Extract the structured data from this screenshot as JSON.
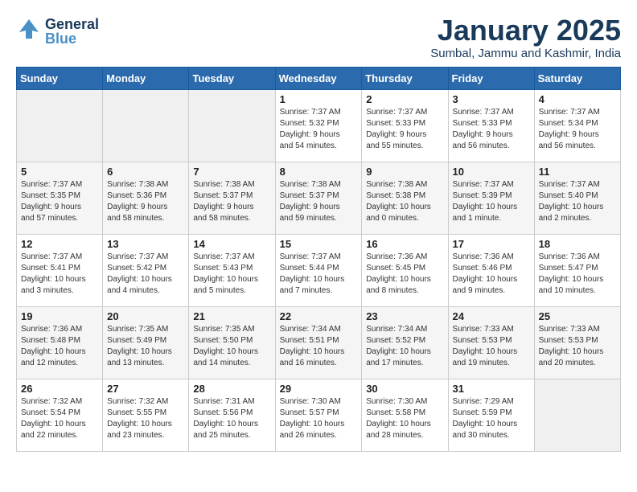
{
  "header": {
    "logo_general": "General",
    "logo_blue": "Blue",
    "month": "January 2025",
    "location": "Sumbal, Jammu and Kashmir, India"
  },
  "days_of_week": [
    "Sunday",
    "Monday",
    "Tuesday",
    "Wednesday",
    "Thursday",
    "Friday",
    "Saturday"
  ],
  "weeks": [
    [
      {
        "day": "",
        "info": ""
      },
      {
        "day": "",
        "info": ""
      },
      {
        "day": "",
        "info": ""
      },
      {
        "day": "1",
        "info": "Sunrise: 7:37 AM\nSunset: 5:32 PM\nDaylight: 9 hours\nand 54 minutes."
      },
      {
        "day": "2",
        "info": "Sunrise: 7:37 AM\nSunset: 5:33 PM\nDaylight: 9 hours\nand 55 minutes."
      },
      {
        "day": "3",
        "info": "Sunrise: 7:37 AM\nSunset: 5:33 PM\nDaylight: 9 hours\nand 56 minutes."
      },
      {
        "day": "4",
        "info": "Sunrise: 7:37 AM\nSunset: 5:34 PM\nDaylight: 9 hours\nand 56 minutes."
      }
    ],
    [
      {
        "day": "5",
        "info": "Sunrise: 7:37 AM\nSunset: 5:35 PM\nDaylight: 9 hours\nand 57 minutes."
      },
      {
        "day": "6",
        "info": "Sunrise: 7:38 AM\nSunset: 5:36 PM\nDaylight: 9 hours\nand 58 minutes."
      },
      {
        "day": "7",
        "info": "Sunrise: 7:38 AM\nSunset: 5:37 PM\nDaylight: 9 hours\nand 58 minutes."
      },
      {
        "day": "8",
        "info": "Sunrise: 7:38 AM\nSunset: 5:37 PM\nDaylight: 9 hours\nand 59 minutes."
      },
      {
        "day": "9",
        "info": "Sunrise: 7:38 AM\nSunset: 5:38 PM\nDaylight: 10 hours\nand 0 minutes."
      },
      {
        "day": "10",
        "info": "Sunrise: 7:37 AM\nSunset: 5:39 PM\nDaylight: 10 hours\nand 1 minute."
      },
      {
        "day": "11",
        "info": "Sunrise: 7:37 AM\nSunset: 5:40 PM\nDaylight: 10 hours\nand 2 minutes."
      }
    ],
    [
      {
        "day": "12",
        "info": "Sunrise: 7:37 AM\nSunset: 5:41 PM\nDaylight: 10 hours\nand 3 minutes."
      },
      {
        "day": "13",
        "info": "Sunrise: 7:37 AM\nSunset: 5:42 PM\nDaylight: 10 hours\nand 4 minutes."
      },
      {
        "day": "14",
        "info": "Sunrise: 7:37 AM\nSunset: 5:43 PM\nDaylight: 10 hours\nand 5 minutes."
      },
      {
        "day": "15",
        "info": "Sunrise: 7:37 AM\nSunset: 5:44 PM\nDaylight: 10 hours\nand 7 minutes."
      },
      {
        "day": "16",
        "info": "Sunrise: 7:36 AM\nSunset: 5:45 PM\nDaylight: 10 hours\nand 8 minutes."
      },
      {
        "day": "17",
        "info": "Sunrise: 7:36 AM\nSunset: 5:46 PM\nDaylight: 10 hours\nand 9 minutes."
      },
      {
        "day": "18",
        "info": "Sunrise: 7:36 AM\nSunset: 5:47 PM\nDaylight: 10 hours\nand 10 minutes."
      }
    ],
    [
      {
        "day": "19",
        "info": "Sunrise: 7:36 AM\nSunset: 5:48 PM\nDaylight: 10 hours\nand 12 minutes."
      },
      {
        "day": "20",
        "info": "Sunrise: 7:35 AM\nSunset: 5:49 PM\nDaylight: 10 hours\nand 13 minutes."
      },
      {
        "day": "21",
        "info": "Sunrise: 7:35 AM\nSunset: 5:50 PM\nDaylight: 10 hours\nand 14 minutes."
      },
      {
        "day": "22",
        "info": "Sunrise: 7:34 AM\nSunset: 5:51 PM\nDaylight: 10 hours\nand 16 minutes."
      },
      {
        "day": "23",
        "info": "Sunrise: 7:34 AM\nSunset: 5:52 PM\nDaylight: 10 hours\nand 17 minutes."
      },
      {
        "day": "24",
        "info": "Sunrise: 7:33 AM\nSunset: 5:53 PM\nDaylight: 10 hours\nand 19 minutes."
      },
      {
        "day": "25",
        "info": "Sunrise: 7:33 AM\nSunset: 5:53 PM\nDaylight: 10 hours\nand 20 minutes."
      }
    ],
    [
      {
        "day": "26",
        "info": "Sunrise: 7:32 AM\nSunset: 5:54 PM\nDaylight: 10 hours\nand 22 minutes."
      },
      {
        "day": "27",
        "info": "Sunrise: 7:32 AM\nSunset: 5:55 PM\nDaylight: 10 hours\nand 23 minutes."
      },
      {
        "day": "28",
        "info": "Sunrise: 7:31 AM\nSunset: 5:56 PM\nDaylight: 10 hours\nand 25 minutes."
      },
      {
        "day": "29",
        "info": "Sunrise: 7:30 AM\nSunset: 5:57 PM\nDaylight: 10 hours\nand 26 minutes."
      },
      {
        "day": "30",
        "info": "Sunrise: 7:30 AM\nSunset: 5:58 PM\nDaylight: 10 hours\nand 28 minutes."
      },
      {
        "day": "31",
        "info": "Sunrise: 7:29 AM\nSunset: 5:59 PM\nDaylight: 10 hours\nand 30 minutes."
      },
      {
        "day": "",
        "info": ""
      }
    ]
  ]
}
